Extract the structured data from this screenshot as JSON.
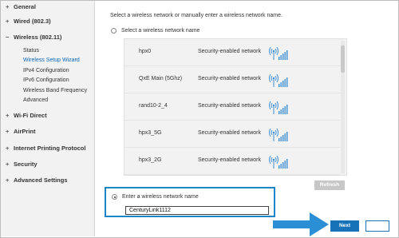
{
  "sidebar": {
    "items": [
      {
        "symbol": "+",
        "label": "General"
      },
      {
        "symbol": "+",
        "label": "Wired (802.3)"
      },
      {
        "symbol": "−",
        "label": "Wireless (802.11)"
      },
      {
        "symbol": "+",
        "label": "Wi-Fi Direct"
      },
      {
        "symbol": "+",
        "label": "AirPrint"
      },
      {
        "symbol": "+",
        "label": "Internet Printing Protocol"
      },
      {
        "symbol": "+",
        "label": "Security"
      },
      {
        "symbol": "+",
        "label": "Advanced Settings"
      }
    ],
    "wireless_subitems": [
      {
        "label": "Status",
        "active": false
      },
      {
        "label": "Wireless Setup Wizard",
        "active": true
      },
      {
        "label": "IPv4 Configuration",
        "active": false
      },
      {
        "label": "IPv6 Configuration",
        "active": false
      },
      {
        "label": "Wireless Band Frequency",
        "active": false
      },
      {
        "label": "Advanced",
        "active": false
      }
    ]
  },
  "main": {
    "instruction": "Select a wireless network or manually enter a wireless network name.",
    "select_option_label": "Select a wireless network name",
    "networks": [
      {
        "ssid": "hpx0",
        "security": "Security-enabled network",
        "signal_icon": "wifi-signal-icon"
      },
      {
        "ssid": "QxE Main (5Ghz)",
        "security": "Security-enabled network",
        "signal_icon": "wifi-signal-icon"
      },
      {
        "ssid": "rand10-2_4",
        "security": "Security-enabled network",
        "signal_icon": "wifi-signal-icon"
      },
      {
        "ssid": "hpx3_5G",
        "security": "Security-enabled network",
        "signal_icon": "wifi-signal-icon"
      },
      {
        "ssid": "hpx3_2G",
        "security": "Security-enabled network",
        "signal_icon": "wifi-signal-icon"
      }
    ],
    "refresh_label": "Refresh",
    "manual_option_label": "Enter a wireless network name",
    "manual_option_selected": true,
    "manual_network_value": "CenturyLink1112",
    "next_label": "Next"
  },
  "colors": {
    "accent": "#1a86c8",
    "primary_button": "#1772b8",
    "signal": "#3c8fd3",
    "sidebar_bg": "#f2f2f2",
    "list_bg": "#f2f2f2",
    "arrow": "#2b8fd6"
  }
}
